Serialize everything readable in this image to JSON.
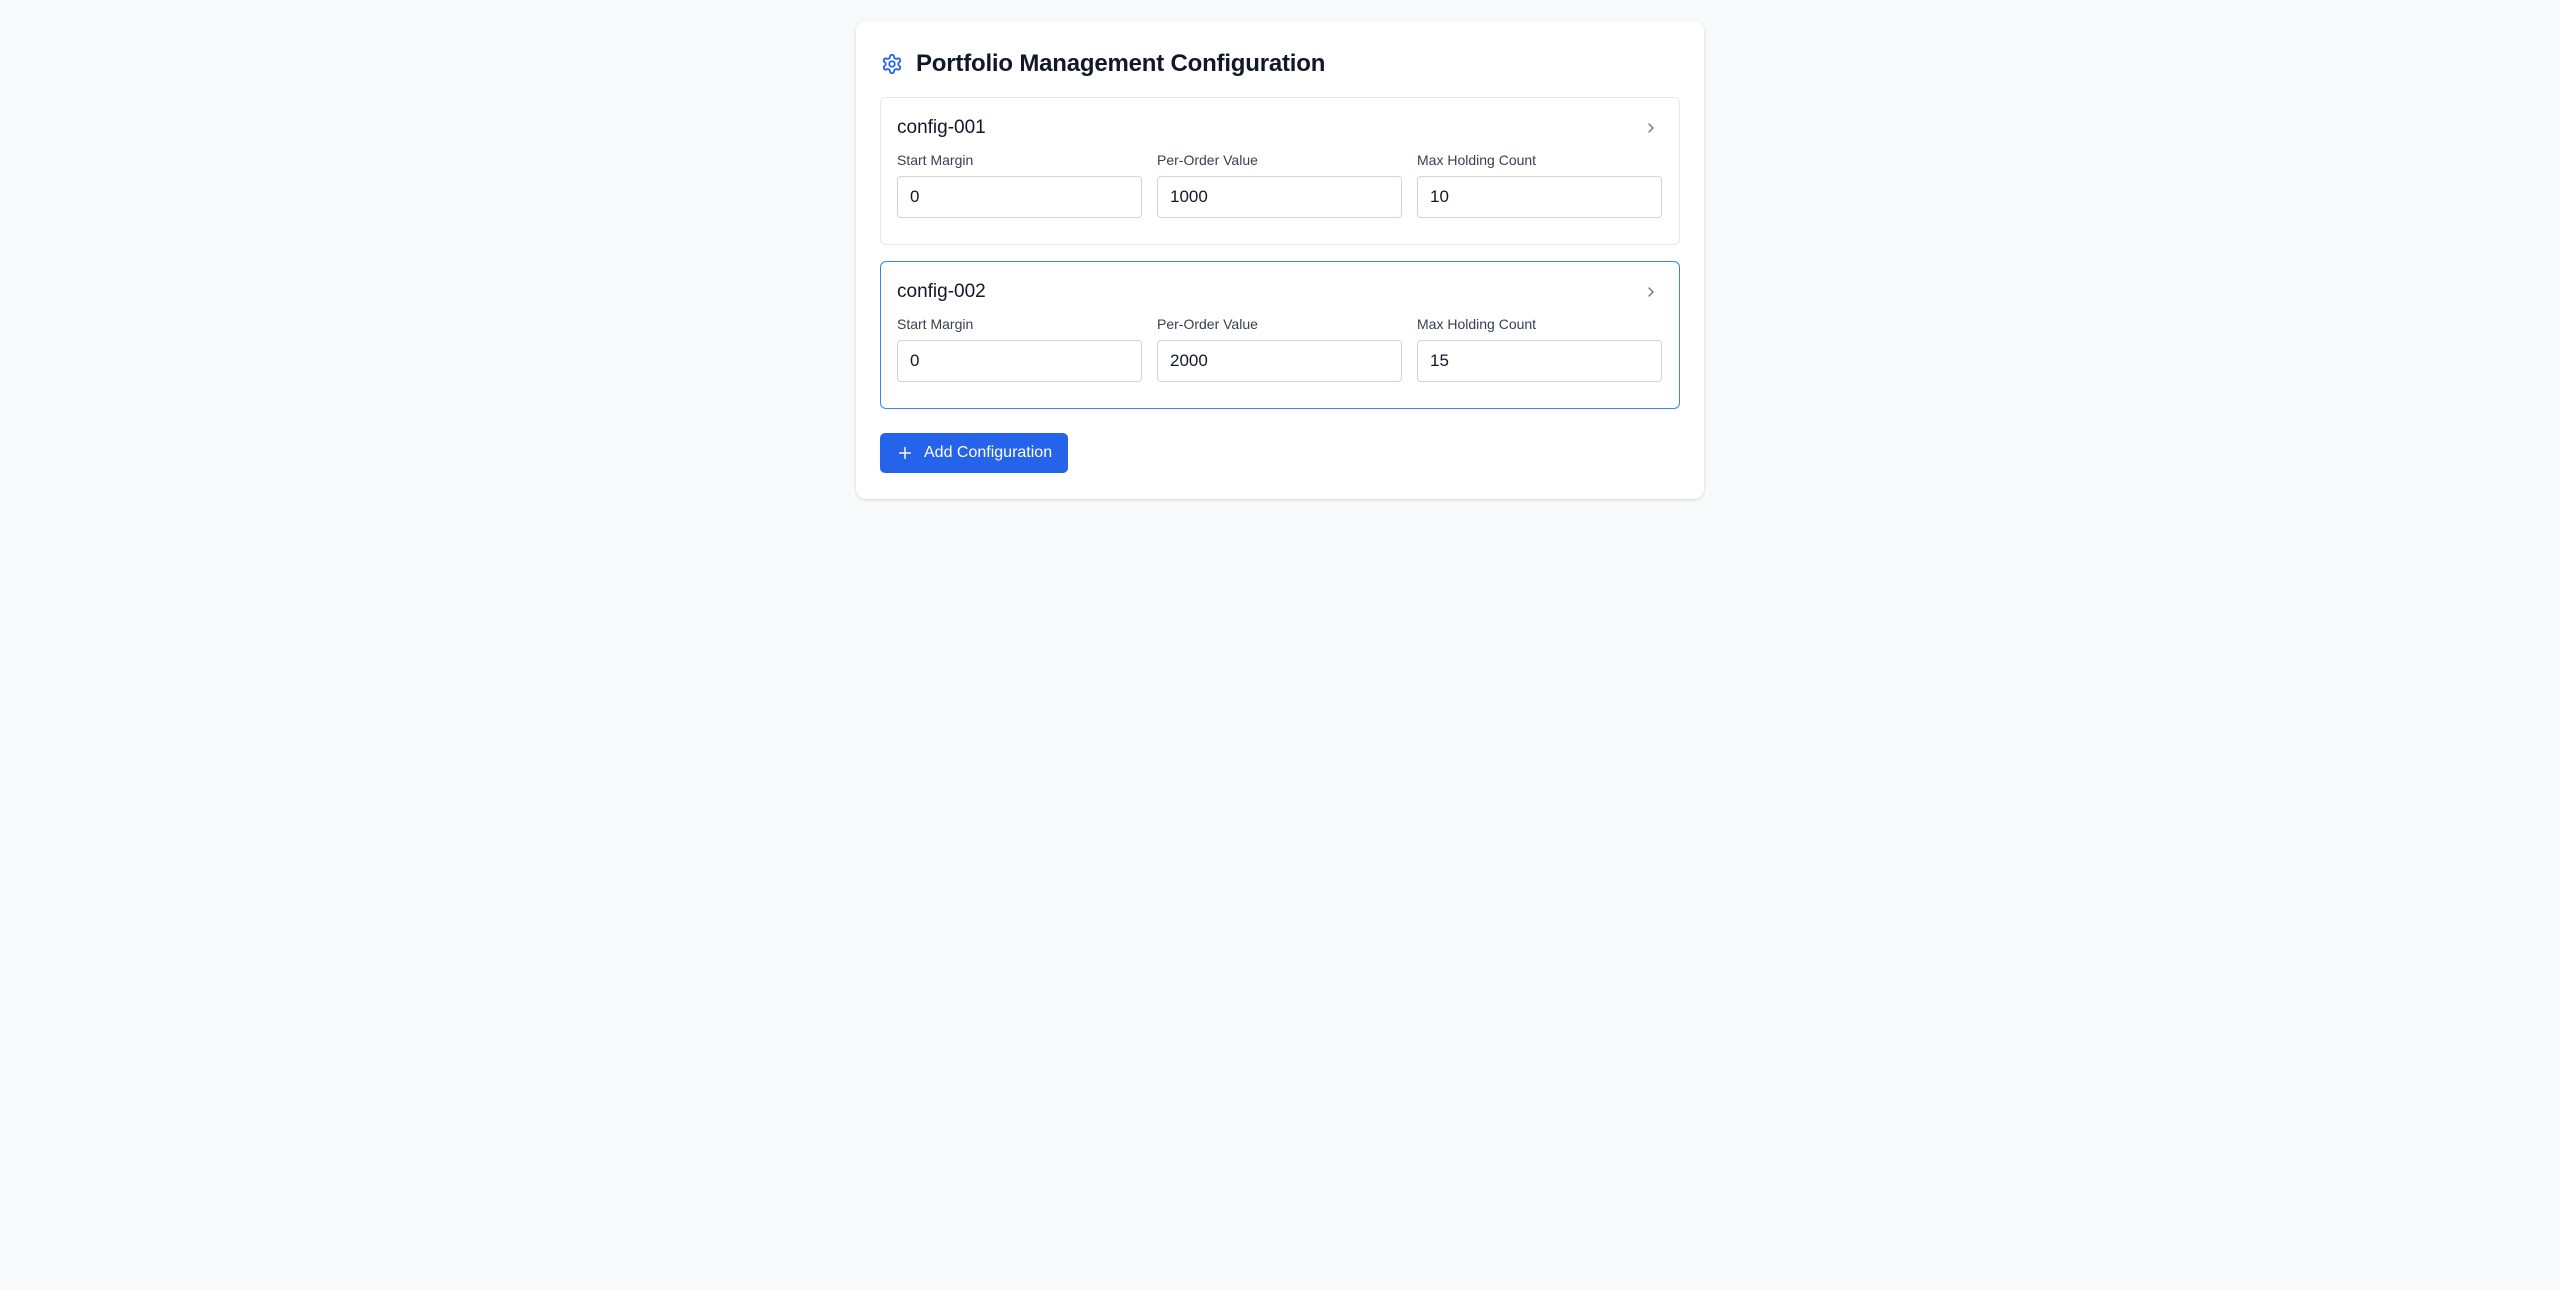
{
  "page": {
    "title": "Portfolio Management Configuration",
    "title_icon": "gear-icon",
    "accent_color": "#2563eb"
  },
  "field_labels": {
    "start_margin": "Start Margin",
    "per_order_value": "Per-Order Value",
    "max_holding_count": "Max Holding Count"
  },
  "configs": [
    {
      "id": "config-001",
      "expand_icon": "chevron-right-icon",
      "start_margin": "0",
      "per_order_value": "1000",
      "max_holding_count": "10",
      "selected": false
    },
    {
      "id": "config-002",
      "expand_icon": "chevron-right-icon",
      "start_margin": "0",
      "per_order_value": "2000",
      "max_holding_count": "15",
      "selected": true
    }
  ],
  "actions": {
    "add_label": "Add Configuration",
    "add_icon": "plus-icon"
  }
}
